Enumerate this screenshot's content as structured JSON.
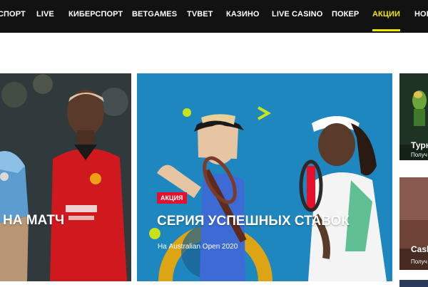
{
  "nav": {
    "items": [
      {
        "label": "СПОРТ"
      },
      {
        "label": "LIVE"
      },
      {
        "label": "КИБЕРСПОРТ"
      },
      {
        "label": "BETGAMES"
      },
      {
        "label": "TVBET"
      },
      {
        "label": "КАЗИНО"
      },
      {
        "label": "LIVE CASINO"
      },
      {
        "label": "ПОКЕР"
      },
      {
        "label": "АКЦИИ"
      },
      {
        "label": "НОВ"
      }
    ],
    "active_label": "АКЦИИ",
    "accent_color": "#f2e600"
  },
  "promos": [
    {
      "title": "НА МАТЧ"
    },
    {
      "badge": "АКЦИЯ",
      "title": "СЕРИЯ УСПЕШНЫХ СТАВОК",
      "subtitle": "На Australian Open 2020"
    },
    {
      "title": "Турн",
      "subtitle": "Получ"
    },
    {
      "title": "Cash",
      "subtitle": "Получ"
    }
  ],
  "badge_color": "#e5102b"
}
